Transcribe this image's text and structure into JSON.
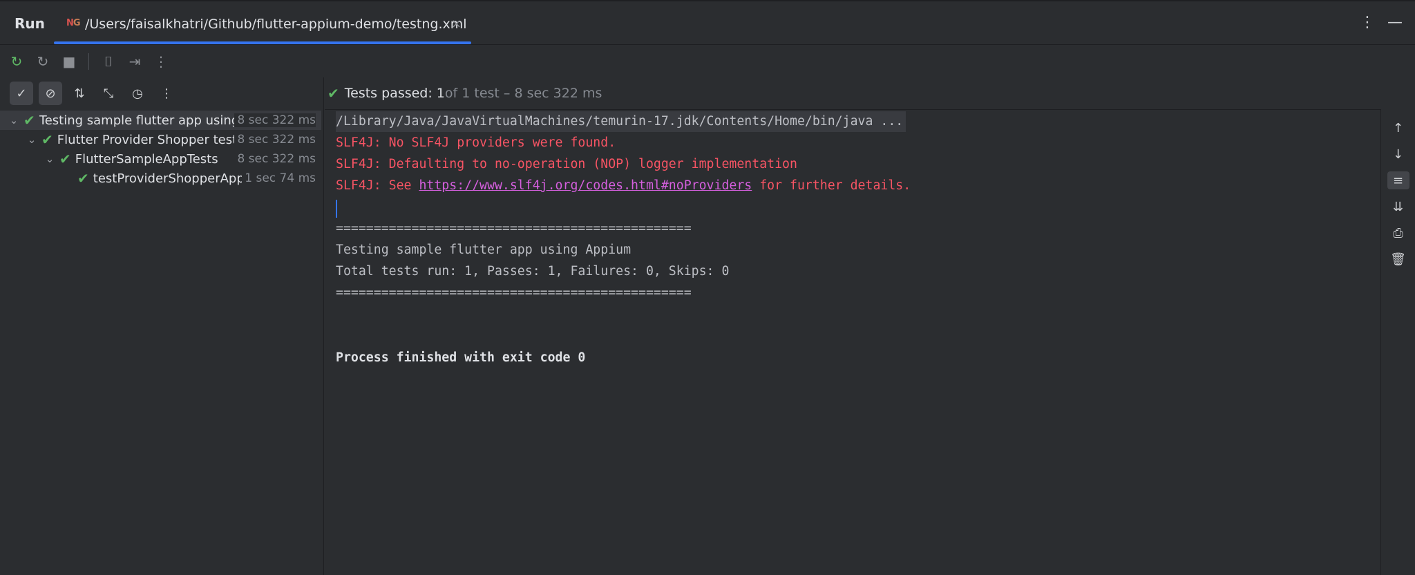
{
  "panel": {
    "title": "Run"
  },
  "tab": {
    "icon_text_n": "N",
    "icon_text_g": "G",
    "title": "/Users/faisalkhatri/Github/flutter-appium-demo/testng.xml",
    "close": "×"
  },
  "top_right": {
    "more": "⋮",
    "minimize": "—"
  },
  "toolbar": {
    "rerun": "↻",
    "rerun_failed": "↻",
    "stop": "■",
    "screenshot": "⌷",
    "export": "⇥",
    "more": "⋮"
  },
  "left_toolbar": {
    "show_passed": "✓",
    "show_ignored": "⊘",
    "sort": "⇅",
    "collapse": "⤡",
    "history": "◷",
    "more": "⋮"
  },
  "tree": [
    {
      "label": "Testing sample flutter app using",
      "time": "8 sec 322 ms",
      "chevron": "⌄",
      "check": "✔"
    },
    {
      "label": "Flutter Provider Shopper tests",
      "time": "8 sec 322 ms",
      "chevron": "⌄",
      "check": "✔"
    },
    {
      "label": "FlutterSampleAppTests",
      "time": "8 sec 322 ms",
      "chevron": "⌄",
      "check": "✔"
    },
    {
      "label": "testProviderShopperApp",
      "time": "1 sec 74 ms",
      "chevron": "",
      "check": "✔"
    }
  ],
  "status": {
    "check": "✔",
    "passed": "Tests passed: 1",
    "detail": " of 1 test – 8 sec 322 ms"
  },
  "console": {
    "cmd": "/Library/Java/JavaVirtualMachines/temurin-17.jdk/Contents/Home/bin/java ...",
    "err1": "SLF4J: No SLF4J providers were found.",
    "err2": "SLF4J: Defaulting to no-operation (NOP) logger implementation",
    "err3_prefix": "SLF4J: See ",
    "err3_link": "https://www.slf4j.org/codes.html#noProviders",
    "err3_suffix": " for further details.",
    "sep1": "===============================================",
    "suite": "Testing sample flutter app using Appium",
    "summary": "Total tests run: 1, Passes: 1, Failures: 0, Skips: 0",
    "sep2": "===============================================",
    "finished": "Process finished with exit code 0"
  },
  "right_strip": {
    "up": "↑",
    "down": "↓",
    "wrap": "≡",
    "scroll_end": "⇊",
    "print": "⎙",
    "clear": "🗑"
  },
  "colors": {
    "accent": "#3574f0",
    "success": "#5fb865",
    "error": "#f75464",
    "link": "#d55fde"
  }
}
